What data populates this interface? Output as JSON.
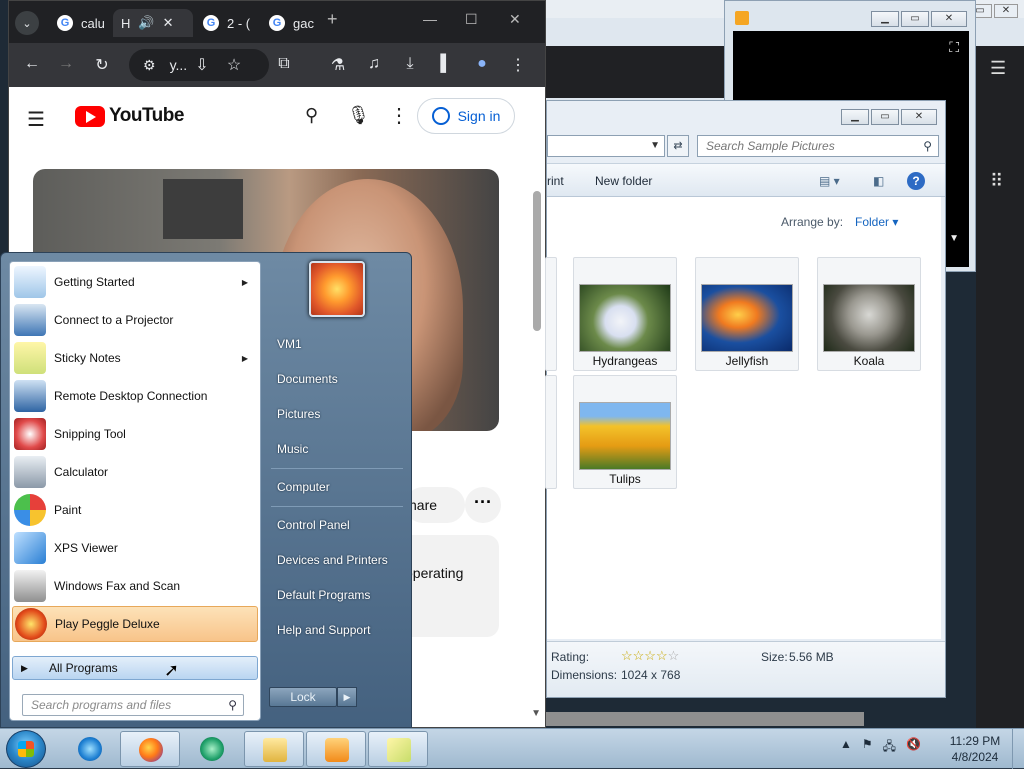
{
  "chrome": {
    "tabs": [
      {
        "label": "calu",
        "icon": "google-icon"
      },
      {
        "label": "H",
        "icon": "audio-icon"
      },
      {
        "label": "2 - (",
        "icon": "google-icon"
      },
      {
        "label": "gac",
        "icon": "google-icon"
      }
    ],
    "omnibox_text": "y...",
    "new_tab": "+"
  },
  "youtube": {
    "logo": "YouTube",
    "sign_in": "Sign in",
    "share": "hare",
    "description_snippet": "operating"
  },
  "explorer": {
    "search_placeholder": "Search Sample Pictures",
    "commands": {
      "print": "rint",
      "new_folder": "New folder"
    },
    "arrange_by_label": "Arrange by:",
    "arrange_by_value": "Folder",
    "items": [
      {
        "name": "Hydrangeas"
      },
      {
        "name": "Jellyfish"
      },
      {
        "name": "Koala"
      },
      {
        "name": "Tulips"
      }
    ],
    "status": {
      "rating_label": "Rating:",
      "size_label": "Size:",
      "size_value": "5.56 MB",
      "dimensions_label": "Dimensions:",
      "dimensions_value": "1024 x 768"
    }
  },
  "start_menu": {
    "programs": [
      {
        "label": "Getting Started",
        "has_submenu": true
      },
      {
        "label": "Connect to a Projector",
        "has_submenu": false
      },
      {
        "label": "Sticky Notes",
        "has_submenu": true
      },
      {
        "label": "Remote Desktop Connection",
        "has_submenu": false
      },
      {
        "label": "Snipping Tool",
        "has_submenu": false
      },
      {
        "label": "Calculator",
        "has_submenu": false
      },
      {
        "label": "Paint",
        "has_submenu": false
      },
      {
        "label": "XPS Viewer",
        "has_submenu": false
      },
      {
        "label": "Windows Fax and Scan",
        "has_submenu": false
      },
      {
        "label": "Play Peggle Deluxe",
        "has_submenu": false
      }
    ],
    "all_programs": "All Programs",
    "search_placeholder": "Search programs and files",
    "right_items": {
      "user": "VM1",
      "documents": "Documents",
      "pictures": "Pictures",
      "music": "Music",
      "computer": "Computer",
      "control_panel": "Control Panel",
      "devices": "Devices and Printers",
      "default_programs": "Default Programs",
      "help": "Help and Support"
    },
    "lock": "Lock"
  },
  "taskbar": {
    "time": "11:29 PM",
    "date": "4/8/2024"
  }
}
